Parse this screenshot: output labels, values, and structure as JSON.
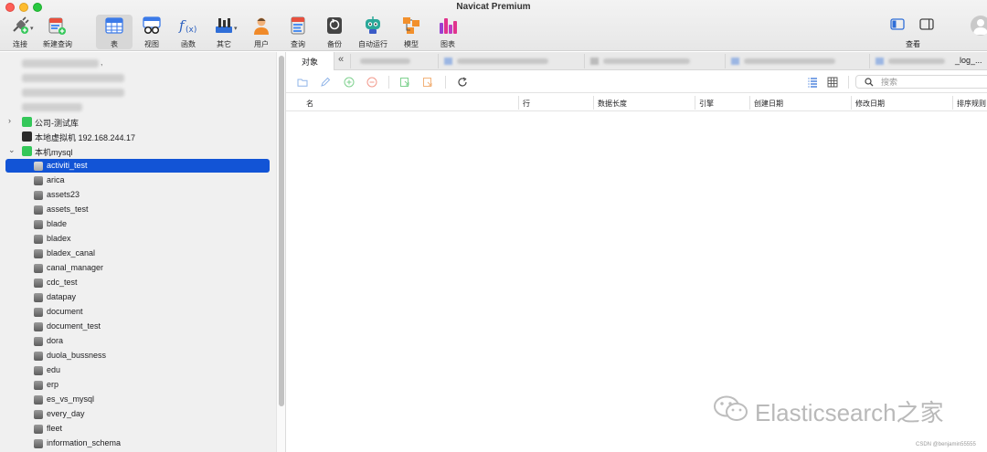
{
  "window": {
    "title": "Navicat Premium"
  },
  "toolbar": {
    "items": [
      {
        "label": "连接",
        "icon": "plug-icon",
        "has_caret": true
      },
      {
        "label": "新建查询",
        "icon": "new-query-icon",
        "has_caret": false
      },
      {
        "label": "表",
        "icon": "table-icon",
        "active": true
      },
      {
        "label": "视图",
        "icon": "view-glasses-icon"
      },
      {
        "label": "函数",
        "icon": "function-icon"
      },
      {
        "label": "其它",
        "icon": "tools-icon",
        "has_caret": true
      },
      {
        "label": "用户",
        "icon": "user-icon"
      },
      {
        "label": "查询",
        "icon": "query-icon"
      },
      {
        "label": "备份",
        "icon": "backup-icon"
      },
      {
        "label": "自动运行",
        "icon": "robot-icon"
      },
      {
        "label": "模型",
        "icon": "model-icon"
      },
      {
        "label": "图表",
        "icon": "chart-icon"
      }
    ],
    "view_label": "查看"
  },
  "sidebar": {
    "blurred_top_text": ",",
    "connections": [
      {
        "label": "公司-测试库",
        "expanded": false,
        "color": "#34c759"
      },
      {
        "label": "本地虚拟机 192.168.244.17",
        "expanded": false,
        "color": "#2b2b2b"
      },
      {
        "label": "本机mysql",
        "expanded": true,
        "color": "#34c759"
      }
    ],
    "databases": [
      "activiti_test",
      "arica",
      "assets23",
      "assets_test",
      "blade",
      "bladex",
      "bladex_canal",
      "canal_manager",
      "cdc_test",
      "datapay",
      "document",
      "document_test",
      "dora",
      "duola_bussness",
      "edu",
      "erp",
      "es_vs_mysql",
      "every_day",
      "fleet",
      "information_schema"
    ],
    "selected_database": "activiti_test"
  },
  "tabs": {
    "active_label": "对象",
    "last_tab_fragment": "_log_..."
  },
  "object_toolbar": {
    "search_placeholder": "搜索"
  },
  "table_header": {
    "columns": [
      "名",
      "行",
      "数据长度",
      "引擎",
      "创建日期",
      "修改日期",
      "排序规则"
    ]
  },
  "watermark": {
    "text": "Elasticsearch之家",
    "credit": "CSDN @benjamin55555"
  },
  "colors": {
    "selection": "#1254d6",
    "green": "#34c759",
    "active_tool_bg": "#d7d7d7"
  }
}
